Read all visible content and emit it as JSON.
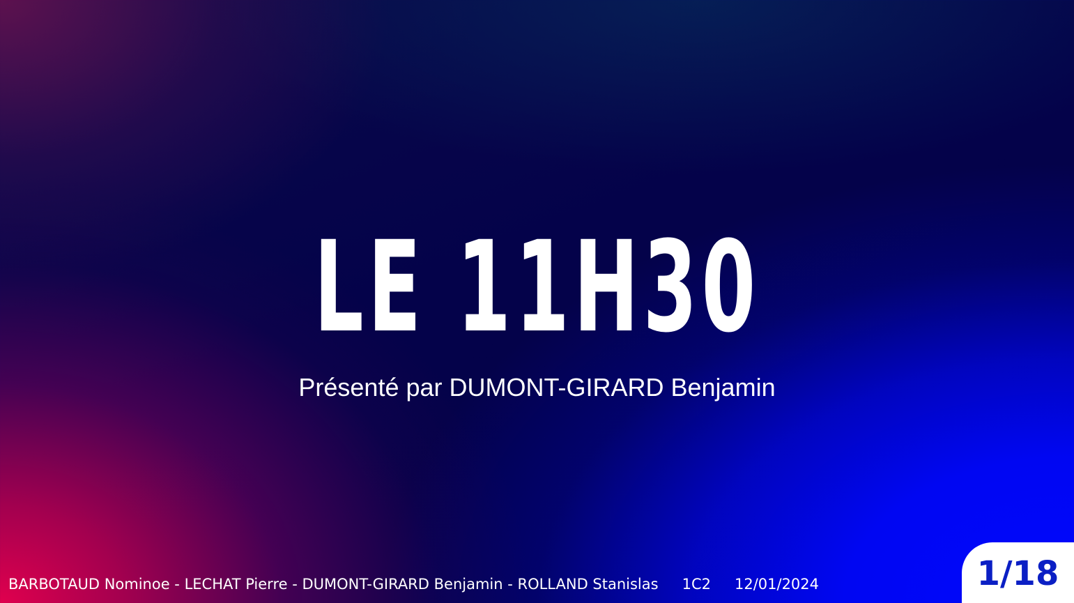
{
  "slide": {
    "title": "LE 11H30",
    "subtitle": "Présenté par DUMONT-GIRARD Benjamin"
  },
  "footer": {
    "authors": "BARBOTAUD Nominoe - LECHAT Pierre - DUMONT-GIRARD Benjamin - ROLLAND Stanislas",
    "class": "1C2",
    "date": "12/01/2024"
  },
  "pagination": {
    "label": "1/18",
    "current": 1,
    "total": 18
  },
  "colors": {
    "background_dark": "#020049",
    "accent_red": "#e0004e",
    "accent_blue": "#0008ff",
    "page_number": "#0b1fc4",
    "text": "#ffffff"
  }
}
